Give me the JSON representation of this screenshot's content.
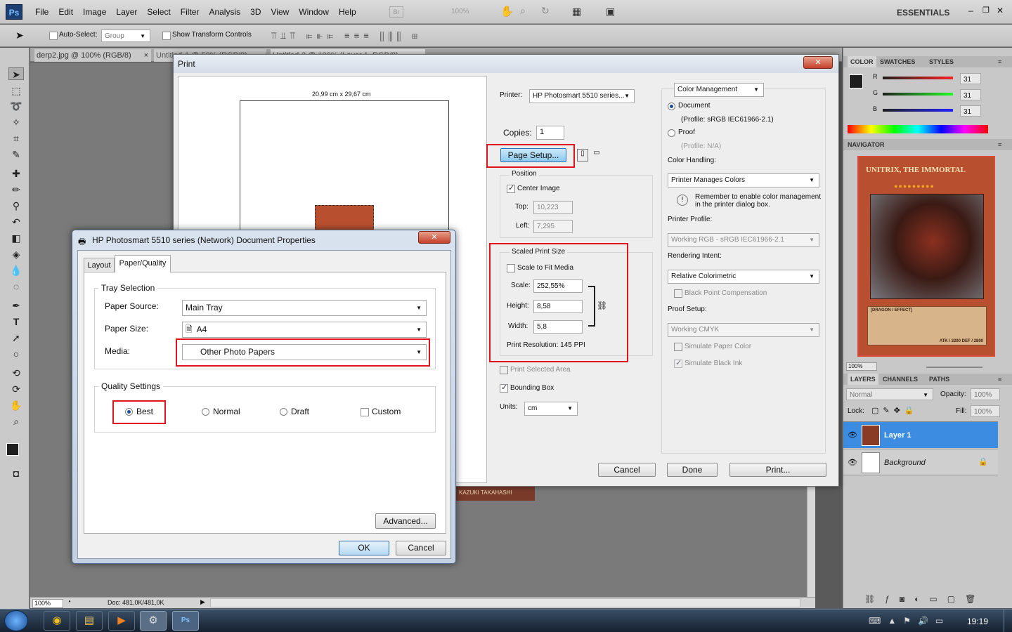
{
  "menu": {
    "logo": "Ps",
    "items": [
      "File",
      "Edit",
      "Image",
      "Layer",
      "Select",
      "Filter",
      "Analysis",
      "3D",
      "View",
      "Window",
      "Help"
    ],
    "br": "Br",
    "zoom": "100%",
    "workspace": "ESSENTIALS"
  },
  "options": {
    "auto_select": "Auto-Select:",
    "group": "Group",
    "show_transform": "Show Transform Controls"
  },
  "tabs": {
    "doc1": "derp2.jpg @ 100% (RGB/8)",
    "close": "×",
    "doc2": "Untitled-1 @ 50% (RGB/8)",
    "doc3": "Untitled-2 @ 100% (Layer 1, RGB/8)"
  },
  "print": {
    "title": "Print",
    "close": "✕",
    "paper_size": "20,99 cm x 29,67 cm",
    "printer_label": "Printer:",
    "printer": "HP Photosmart 5510 series...",
    "copies_label": "Copies:",
    "copies": "1",
    "page_setup": "Page Setup...",
    "position": {
      "legend": "Position",
      "center": "Center Image",
      "top_label": "Top:",
      "top": "10,223",
      "left_label": "Left:",
      "left": "7,295"
    },
    "scaled": {
      "legend": "Scaled Print Size",
      "fit": "Scale to Fit Media",
      "scale_label": "Scale:",
      "scale": "252,55%",
      "height_label": "Height:",
      "height": "8,58",
      "width_label": "Width:",
      "width": "5,8",
      "resolution": "Print Resolution: 145 PPI"
    },
    "print_selected": "Print Selected Area",
    "bounding_box": "Bounding Box",
    "units_label": "Units:",
    "units": "cm",
    "cm": {
      "mode": "Color Management",
      "document": "Document",
      "doc_profile": "(Profile: sRGB IEC61966-2.1)",
      "proof": "Proof",
      "proof_profile": "(Profile: N/A)",
      "handling_label": "Color Handling:",
      "handling": "Printer Manages Colors",
      "remember": "Remember to enable color management in the printer dialog box.",
      "printer_profile_label": "Printer Profile:",
      "printer_profile": "Working RGB - sRGB IEC61966-2.1",
      "intent_label": "Rendering Intent:",
      "intent": "Relative Colorimetric",
      "bpc": "Black Point Compensation",
      "proof_setup_label": "Proof Setup:",
      "proof_setup": "Working CMYK",
      "sim_paper": "Simulate Paper Color",
      "sim_ink": "Simulate Black Ink"
    },
    "cancel": "Cancel",
    "done": "Done",
    "print_btn": "Print..."
  },
  "props": {
    "title": "HP Photosmart 5510 series (Network) Document Properties",
    "tab_layout": "Layout",
    "tab_paper": "Paper/Quality",
    "tray_legend": "Tray Selection",
    "source_label": "Paper Source:",
    "source": "Main Tray",
    "size_label": "Paper Size:",
    "size": "A4",
    "media_label": "Media:",
    "media": "Other Photo Papers",
    "quality_legend": "Quality Settings",
    "best": "Best",
    "normal": "Normal",
    "draft": "Draft",
    "custom": "Custom",
    "advanced": "Advanced...",
    "ok": "OK",
    "cancel": "Cancel",
    "close": "✕"
  },
  "panels": {
    "color_tabs": [
      "COLOR",
      "SWATCHES",
      "STYLES"
    ],
    "r": "R",
    "g": "G",
    "b": "B",
    "r_val": "31",
    "g_val": "31",
    "b_val": "31",
    "navigator": "NAVIGATOR",
    "nav_zoom": "100%",
    "card_title": "UNITRIX, THE IMMORTAL",
    "card_type": "[DRAGON / EFFECT]",
    "card_stats": "ATK / 3200  DEF / 2800",
    "layers_tabs": [
      "LAYERS",
      "CHANNELS",
      "PATHS"
    ],
    "blend": "Normal",
    "opacity_label": "Opacity:",
    "opacity": "100%",
    "lock_label": "Lock:",
    "fill_label": "Fill:",
    "fill": "100%",
    "layer1": "Layer 1",
    "background": "Background"
  },
  "status": {
    "zoom": "100%",
    "doc": "Doc: 481,0K/481,0K"
  },
  "canvas": {
    "credit": "KAZUKI TAKAHASHI"
  },
  "taskbar": {
    "time": "19:19"
  },
  "colors": {
    "accent": "#e0141b",
    "ps_blue": "#2b6db5",
    "layer_sel": "#3c8de2"
  }
}
